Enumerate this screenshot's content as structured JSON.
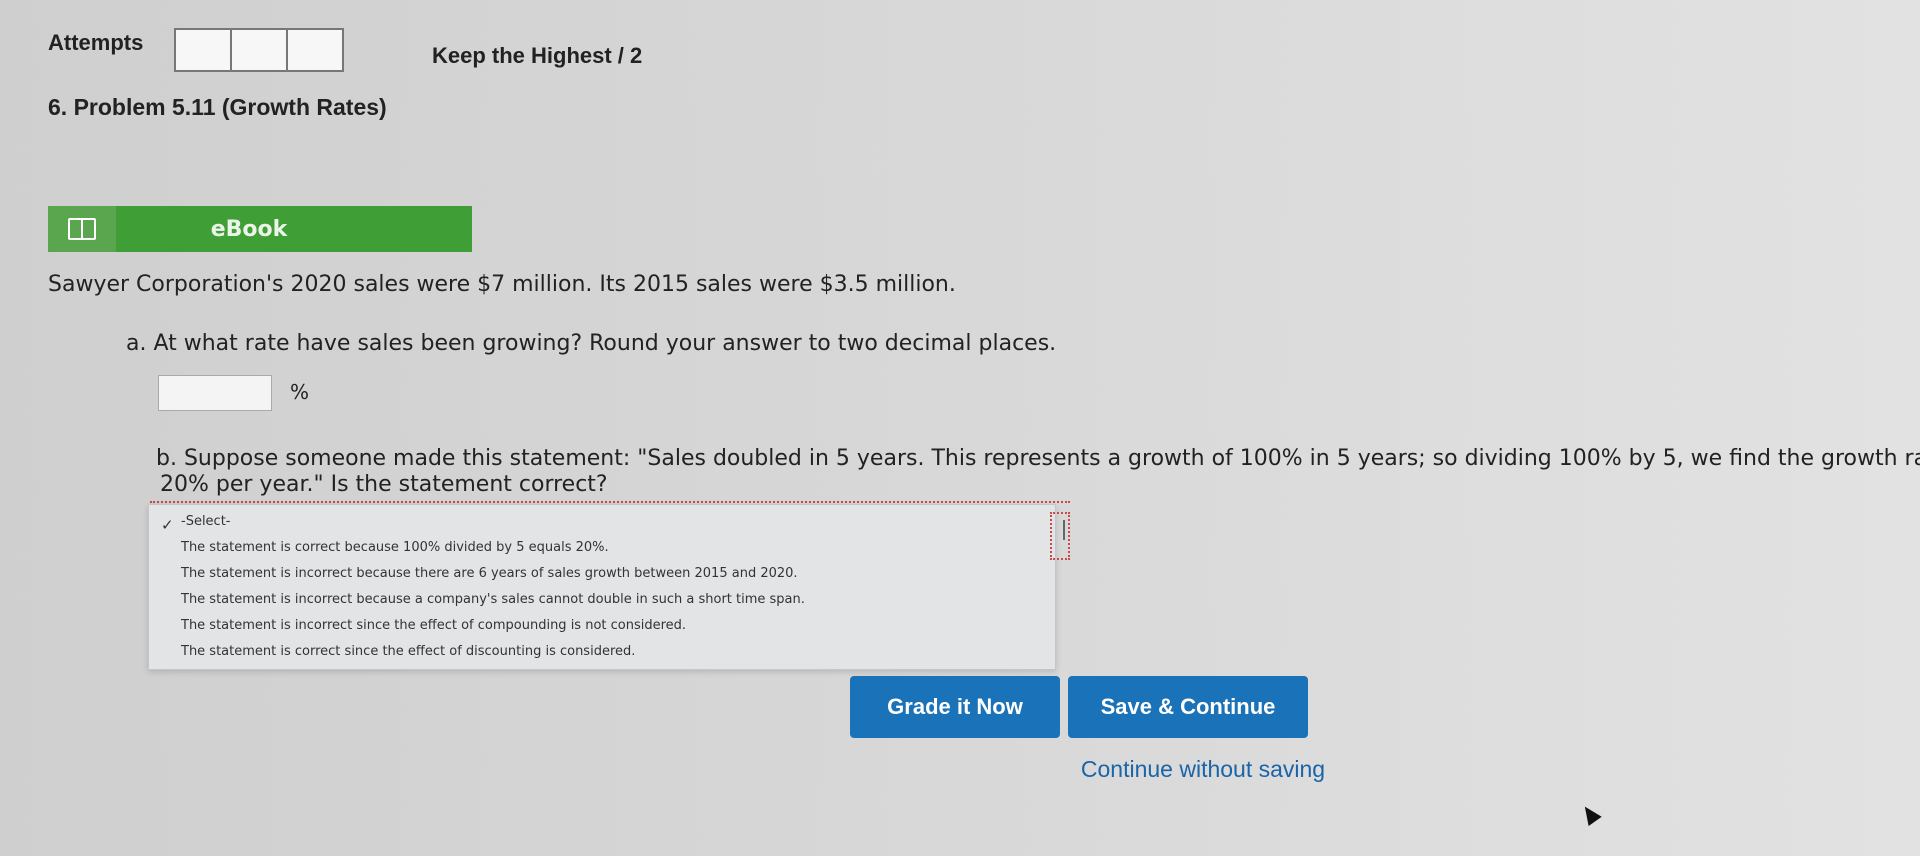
{
  "header": {
    "attempts_label": "Attempts",
    "keep_label": "Keep the Highest / 2",
    "attempt_box_count": 3
  },
  "problem": {
    "title": "6. Problem 5.11 (Growth Rates)",
    "ebook_label": "eBook",
    "statement": "Sawyer Corporation's 2020 sales were $7 million. Its 2015 sales were $3.5 million.",
    "question_a": "a. At what rate have sales been growing? Round your answer to two decimal places.",
    "answer_a_value": "",
    "percent_unit": "%",
    "question_b_line1": "b. Suppose someone made this statement: \"Sales doubled in 5 years. This represents a growth of 100% in 5 years; so dividing 100% by 5, we find the growth rate to be",
    "question_b_line2": "20% per year.\" Is the statement correct?"
  },
  "dropdown": {
    "selected": "-Select-",
    "options": [
      "The statement is correct because 100% divided by 5 equals 20%.",
      "The statement is incorrect because there are 6 years of sales growth between 2015 and 2020.",
      "The statement is incorrect because a company's sales cannot double in such a short time span.",
      "The statement is incorrect since the effect of compounding is not considered.",
      "The statement is correct since the effect of discounting is considered."
    ]
  },
  "actions": {
    "grade_label": "Grade it Now",
    "save_label": "Save & Continue",
    "continue_label": "Continue without saving"
  },
  "colors": {
    "primary_button": "#1a72b8",
    "ebook_green": "#3f9e36",
    "link_blue": "#1a64a8"
  }
}
